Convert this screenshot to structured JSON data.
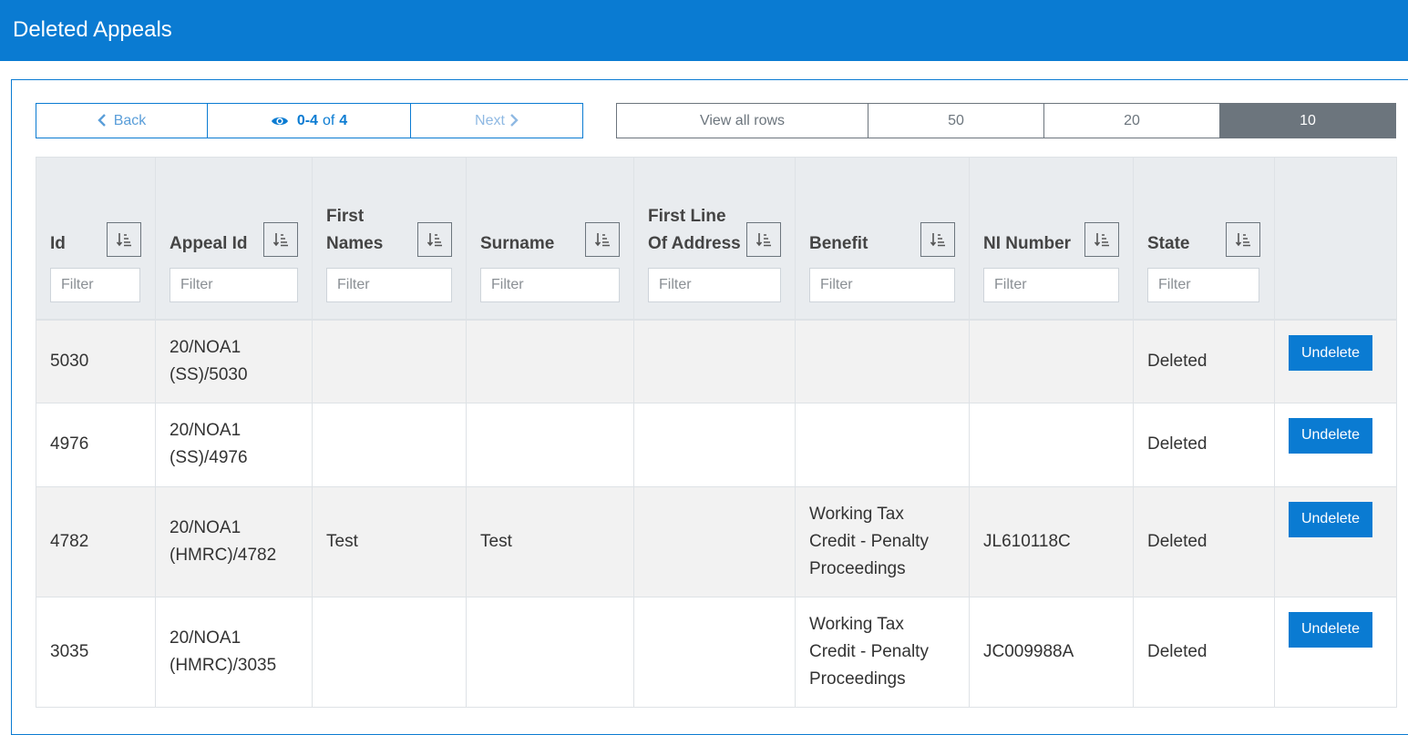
{
  "page": {
    "title": "Deleted Appeals"
  },
  "pager": {
    "back_label": "Back",
    "range": "0-4",
    "of_label": "of",
    "total": "4",
    "next_label": "Next"
  },
  "page_sizes": {
    "all": "View all rows",
    "s50": "50",
    "s20": "20",
    "s10": "10",
    "selected": "10"
  },
  "table": {
    "filter_placeholder": "Filter",
    "columns": [
      {
        "label": "Id"
      },
      {
        "label": "Appeal Id"
      },
      {
        "label": "First Names"
      },
      {
        "label": "Surname"
      },
      {
        "label": "First Line Of Address"
      },
      {
        "label": "Benefit"
      },
      {
        "label": "NI Number"
      },
      {
        "label": "State"
      }
    ],
    "action_label": "Undelete",
    "rows": [
      {
        "id": "5030",
        "appeal_id_1": "20/NOA1",
        "appeal_id_2": "(SS)/5030",
        "first_names": "",
        "surname": "",
        "address": "",
        "benefit_1": "",
        "benefit_2": "",
        "benefit_3": "",
        "ni_number": "",
        "state": "Deleted"
      },
      {
        "id": "4976",
        "appeal_id_1": "20/NOA1",
        "appeal_id_2": "(SS)/4976",
        "first_names": "",
        "surname": "",
        "address": "",
        "benefit_1": "",
        "benefit_2": "",
        "benefit_3": "",
        "ni_number": "",
        "state": "Deleted"
      },
      {
        "id": "4782",
        "appeal_id_1": "20/NOA1",
        "appeal_id_2": "(HMRC)/4782",
        "first_names": "Test",
        "surname": "Test",
        "address": "",
        "benefit_1": "Working Tax",
        "benefit_2": "Credit - Penalty",
        "benefit_3": "Proceedings",
        "ni_number": "JL610118C",
        "state": "Deleted"
      },
      {
        "id": "3035",
        "appeal_id_1": "20/NOA1",
        "appeal_id_2": "(HMRC)/3035",
        "first_names": "",
        "surname": "",
        "address": "",
        "benefit_1": "Working Tax",
        "benefit_2": "Credit - Penalty",
        "benefit_3": "Proceedings",
        "ni_number": "JC009988A",
        "state": "Deleted"
      }
    ]
  },
  "colors": {
    "primary": "#0a7bd2",
    "secondary": "#6c757d",
    "header_bg": "#e9ecef",
    "stripe": "#f2f2f2"
  }
}
